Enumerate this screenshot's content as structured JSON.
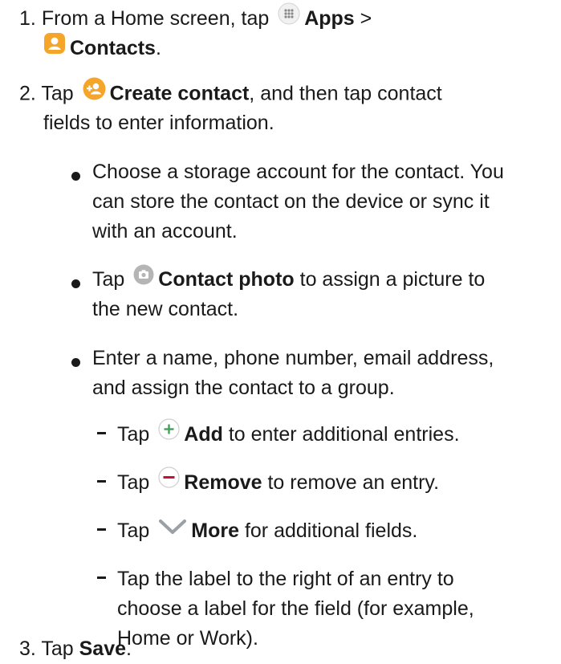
{
  "steps": {
    "s1": {
      "num": "1.",
      "pre": "From a Home screen, tap",
      "apps": "Apps",
      "gt": ">",
      "contacts": "Contacts",
      "end": "."
    },
    "s2": {
      "num": "2.",
      "pre": "Tap",
      "create": "Create contact",
      "rest": ", and then tap contact",
      "line2": "fields to enter information.",
      "b1": {
        "l1": "Choose a storage account for the contact. You",
        "l2": "can store the contact on the device or sync it",
        "l3": "with an account."
      },
      "b2": {
        "pre": "Tap",
        "photo": "Contact photo",
        "rest": "to assign a picture to",
        "l2": "the new contact."
      },
      "b3": {
        "l1": "Enter a name, phone number, email address,",
        "l2": "and assign the contact to a group.",
        "d1": {
          "pre": "Tap",
          "bold": "Add",
          "rest": "to enter additional entries."
        },
        "d2": {
          "pre": "Tap",
          "bold": "Remove",
          "rest": "to remove an entry."
        },
        "d3": {
          "pre": "Tap",
          "bold": "More",
          "rest": "for additional fields."
        },
        "d4": {
          "l1": "Tap the label to the right of an entry to",
          "l2": "choose a label for the field (for example,",
          "l3": "Home or Work)."
        }
      }
    },
    "s3": {
      "num": "3.",
      "pre": "Tap",
      "save": "Save",
      "end": "."
    }
  },
  "icons": {
    "apps": "apps-grid-icon",
    "contacts": "contacts-app-icon",
    "create": "create-contact-icon",
    "photo": "camera-icon",
    "add": "add-plus-icon",
    "remove": "remove-minus-icon",
    "more": "chevron-down-icon"
  },
  "colors": {
    "accent_orange": "#f5a52a",
    "add_green": "#3aa655",
    "remove_red": "#c8102e",
    "chevron_gray": "#9aa0a6",
    "photo_gray": "#b5b5b5"
  }
}
